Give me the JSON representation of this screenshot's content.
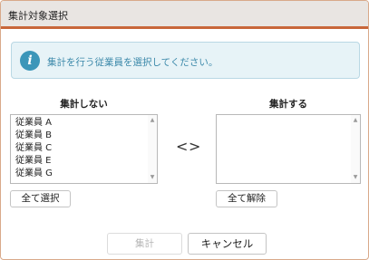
{
  "dialog": {
    "title": "集計対象選択"
  },
  "info": {
    "icon": "info-icon",
    "message": "集計を行う従業員を選択してください。"
  },
  "exclude_panel": {
    "heading": "集計しない",
    "items": [
      "従業員 A",
      "従業員 B",
      "従業員 C",
      "従業員 E",
      "従業員 G"
    ],
    "select_all_label": "全て選択"
  },
  "include_panel": {
    "heading": "集計する",
    "items": [],
    "deselect_all_label": "全て解除"
  },
  "move_controls": {
    "left": "<",
    "right": ">"
  },
  "footer": {
    "aggregate_label": "集計",
    "aggregate_enabled": false,
    "cancel_label": "キャンセル"
  },
  "colors": {
    "title_accent": "#c8663a",
    "info_bg": "#e7f3f7",
    "info_icon": "#3b96b9",
    "info_text": "#3c89aa"
  }
}
